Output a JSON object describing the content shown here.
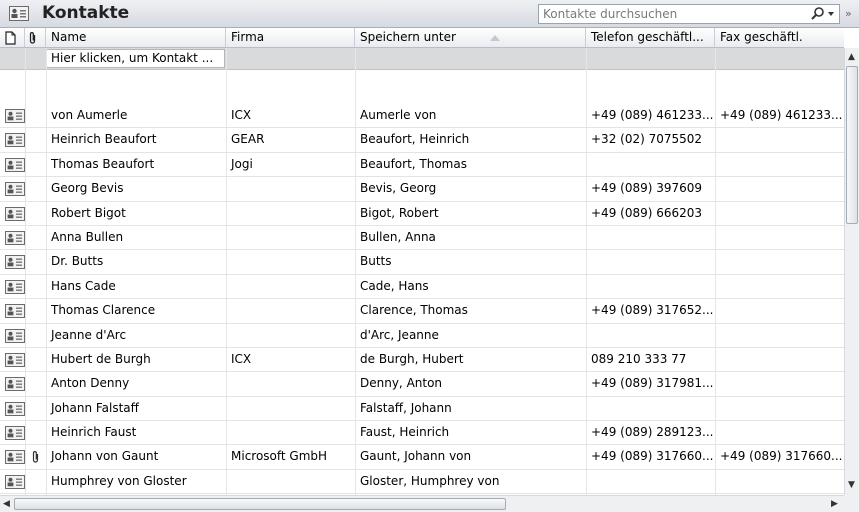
{
  "window": {
    "title": "Kontakte",
    "search_placeholder": "Kontakte durchsuchen",
    "search_icon": "magnifier-icon",
    "expand_icon": "double-chevron-icon",
    "expand_glyph": "»"
  },
  "columns": [
    {
      "id": "type",
      "label": "",
      "icon": "page-icon"
    },
    {
      "id": "attach",
      "label": "",
      "icon": "paperclip-icon"
    },
    {
      "id": "name",
      "label": "Name"
    },
    {
      "id": "company",
      "label": "Firma"
    },
    {
      "id": "file_as",
      "label": "Speichern unter",
      "sorted": "ascending"
    },
    {
      "id": "phone",
      "label": "Telefon geschäftl..."
    },
    {
      "id": "fax",
      "label": "Fax geschäftl."
    }
  ],
  "new_row_text": "Hier klicken, um Kontakt ...",
  "contacts": [
    {
      "attach": "",
      "name": "von Aumerle",
      "company": "ICX",
      "file_as": "Aumerle von",
      "phone": "+49 (089) 461233...",
      "fax": "+49 (089) 461233..."
    },
    {
      "attach": "",
      "name": "Heinrich Beaufort",
      "company": "GEAR",
      "file_as": "Beaufort, Heinrich",
      "phone": "+32 (02) 7075502",
      "fax": ""
    },
    {
      "attach": "",
      "name": "Thomas Beaufort",
      "company": "Jogi",
      "file_as": "Beaufort, Thomas",
      "phone": "",
      "fax": ""
    },
    {
      "attach": "",
      "name": "Georg Bevis",
      "company": "",
      "file_as": "Bevis, Georg",
      "phone": "+49 (089) 397609",
      "fax": ""
    },
    {
      "attach": "",
      "name": "Robert Bigot",
      "company": "",
      "file_as": "Bigot, Robert",
      "phone": "+49 (089) 666203",
      "fax": ""
    },
    {
      "attach": "",
      "name": "Anna Bullen",
      "company": "",
      "file_as": "Bullen, Anna",
      "phone": "",
      "fax": ""
    },
    {
      "attach": "",
      "name": "Dr. Butts",
      "company": "",
      "file_as": "Butts",
      "phone": "",
      "fax": ""
    },
    {
      "attach": "",
      "name": "Hans Cade",
      "company": "",
      "file_as": "Cade, Hans",
      "phone": "",
      "fax": ""
    },
    {
      "attach": "",
      "name": "Thomas Clarence",
      "company": "",
      "file_as": "Clarence, Thomas",
      "phone": "+49 (089) 317652...",
      "fax": ""
    },
    {
      "attach": "",
      "name": "Jeanne d'Arc",
      "company": "",
      "file_as": "d'Arc, Jeanne",
      "phone": "",
      "fax": ""
    },
    {
      "attach": "",
      "name": "Hubert de Burgh",
      "company": "ICX",
      "file_as": "de Burgh, Hubert",
      "phone": "089 210 333 77",
      "fax": ""
    },
    {
      "attach": "",
      "name": "Anton Denny",
      "company": "",
      "file_as": "Denny, Anton",
      "phone": "+49 (089) 317981...",
      "fax": ""
    },
    {
      "attach": "",
      "name": "Johann Falstaff",
      "company": "",
      "file_as": "Falstaff, Johann",
      "phone": "",
      "fax": ""
    },
    {
      "attach": "",
      "name": "Heinrich Faust",
      "company": "",
      "file_as": "Faust, Heinrich",
      "phone": "+49 (089) 289123...",
      "fax": ""
    },
    {
      "attach": "paperclip",
      "name": "Johann von Gaunt",
      "company": "Microsoft GmbH",
      "file_as": "Gaunt, Johann von",
      "phone": "+49 (089) 317660...",
      "fax": "+49 (089) 317660..."
    },
    {
      "attach": "",
      "name": "Humphrey von Gloster",
      "company": "",
      "file_as": "Gloster, Humphrey von",
      "phone": "",
      "fax": ""
    }
  ],
  "colors": {
    "header_bg": "#e9ecf0",
    "new_row_bg": "#d9dadc",
    "grid_line": "#e4e4e4"
  }
}
